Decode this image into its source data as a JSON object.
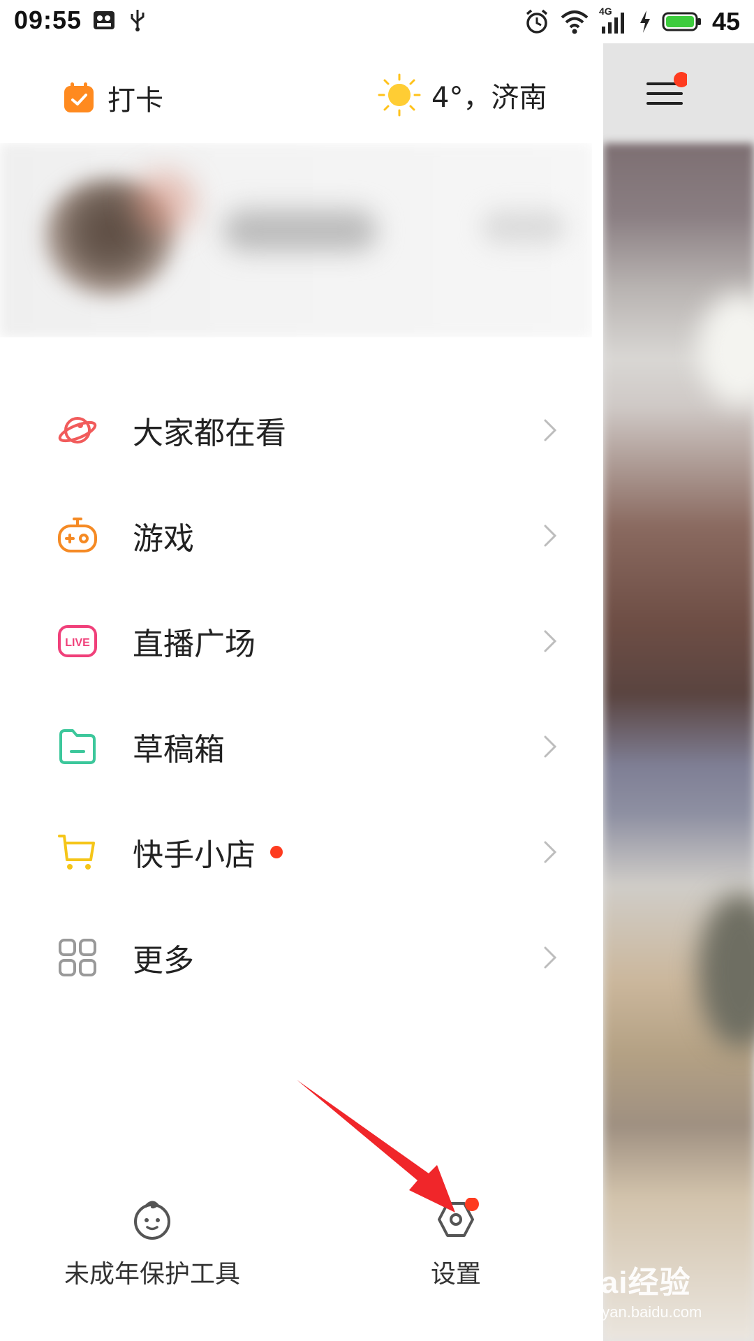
{
  "status_bar": {
    "time": "09:55",
    "network": "4G",
    "battery": "45",
    "icons": [
      "notification-app-icon",
      "usb-icon",
      "alarm-icon",
      "wifi-icon",
      "signal-icon",
      "charging-icon",
      "battery-icon"
    ]
  },
  "header": {
    "checkin_label": "打卡",
    "weather_label": "4°，济南",
    "weather_icon": "sun-icon",
    "menu_icon": "hamburger-menu-icon",
    "menu_has_badge": true
  },
  "menu": {
    "items": [
      {
        "label": "大家都在看",
        "icon": "planet-icon",
        "color": "#f15b5b"
      },
      {
        "label": "游戏",
        "icon": "gamepad-icon",
        "color": "#f58a24"
      },
      {
        "label": "直播广场",
        "icon": "live-icon",
        "color": "#f0407a",
        "icon_text": "LIVE"
      },
      {
        "label": "草稿箱",
        "icon": "folder-icon",
        "color": "#3cc79b"
      },
      {
        "label": "快手小店",
        "icon": "cart-icon",
        "color": "#f5c518",
        "badge": true
      },
      {
        "label": "更多",
        "icon": "grid-icon",
        "color": "#999999"
      }
    ]
  },
  "bottom": {
    "minor_protection_label": "未成年保护工具",
    "settings_label": "设置"
  },
  "watermark": {
    "main": "Bai经验",
    "sub": "jingyan.baidu.com"
  },
  "colors": {
    "accent_orange": "#ff8a1f",
    "badge_red": "#fe3b1f",
    "annotation_arrow": "#f0262a"
  }
}
